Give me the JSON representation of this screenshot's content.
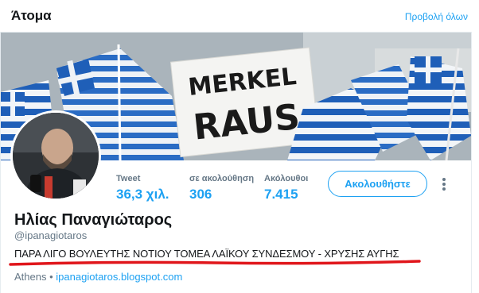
{
  "header": {
    "title": "Άτομα",
    "view_all": "Προβολή όλων"
  },
  "banner": {
    "sign_line1": "MERKEL",
    "sign_line2": "RAUS"
  },
  "stats": [
    {
      "label": "Tweet",
      "value": "36,3 χιλ."
    },
    {
      "label": "σε ακολούθηση",
      "value": "306"
    },
    {
      "label": "Ακόλουθοι",
      "value": "7.415"
    }
  ],
  "actions": {
    "follow_label": "Ακολουθήστε",
    "more_icon": "more-vertical-icon"
  },
  "profile": {
    "name": "Ηλίας Παναγιώταρος",
    "handle": "@ipanagiotaros",
    "bio": "ΠΑΡΑ ΛΙΓΟ ΒΟΥΛΕΥΤΗΣ ΝΟΤΙΟΥ ΤΟΜΕΑ ΛΑΪΚΟΥ ΣΥΝΔΕΣΜΟΥ - ΧΡΥΣΗΣ ΑΥΓΗΣ",
    "location": "Athens",
    "separator": "•",
    "website": "ipanagiotaros.blogspot.com"
  },
  "colors": {
    "accent": "#1da1f2",
    "annotation_underline": "#e0161b",
    "flag_blue": "#1f5fb8"
  }
}
